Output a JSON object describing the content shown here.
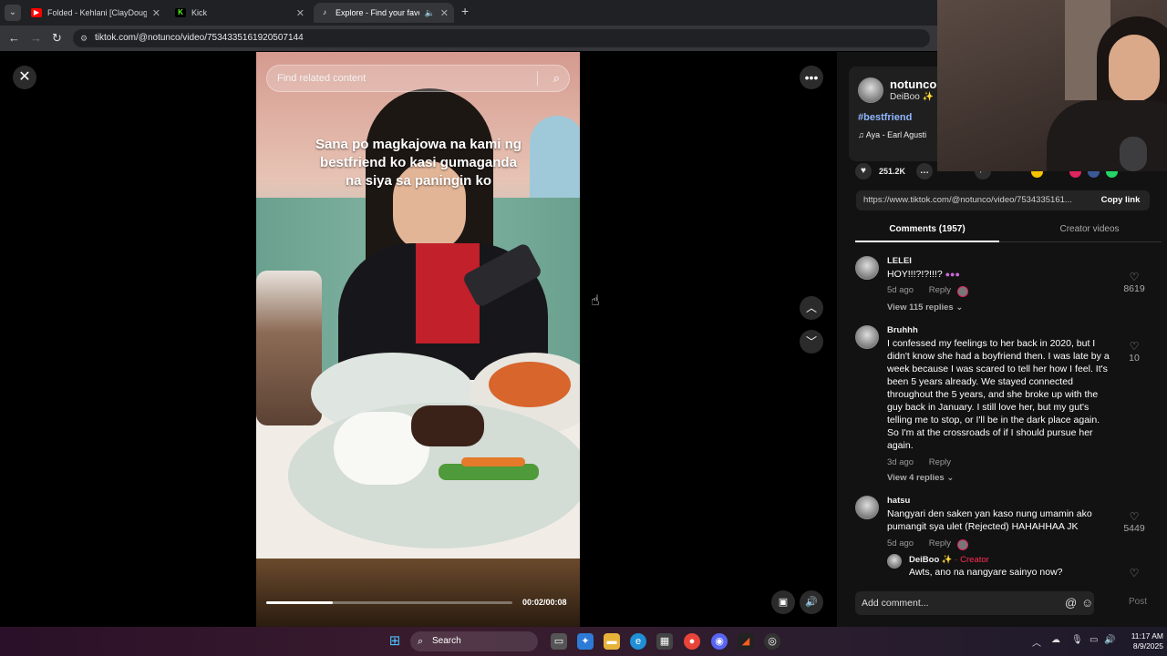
{
  "browser": {
    "tabs": [
      {
        "title": "Folded - Kehlani [ClayDough re",
        "favicon": "youtube-icon",
        "color": "#ff0000"
      },
      {
        "title": "Kick",
        "favicon": "kick-icon",
        "color": "#53fc18"
      },
      {
        "title": "Explore - Find your favourit",
        "favicon": "tiktok-icon",
        "color": "#ffffff",
        "active": true
      }
    ],
    "url": "tiktok.com/@notunco/video/7534335161920507144"
  },
  "video": {
    "search_placeholder": "Find related content",
    "caption": "Sana po magkajowa na kami ng bestfriend ko kasi gumaganda na siya sa paningin ko",
    "time": "00:02/00:08",
    "progress": 0.27
  },
  "panel": {
    "author": {
      "username": "notunco",
      "nickname": "DeiBoo ✨"
    },
    "hashtag": "#bestfriend",
    "music": "Aya - Earl Agusti",
    "stats": {
      "likes": "251.2K"
    },
    "link": "https://www.tiktok.com/@notunco/video/7534335161...",
    "copy_link_label": "Copy link",
    "tabs": {
      "comments": "Comments (1957)",
      "creator": "Creator videos"
    },
    "comments": [
      {
        "user": "LELEI",
        "text": "HOY!!!?!?!!!?",
        "time": "5d ago",
        "reply": "Reply",
        "likes": "8619",
        "replies": "View 115 replies"
      },
      {
        "user": "Bruhhh",
        "text": "I confessed my feelings to her back in 2020, but I didn't know she had a boyfriend then. I was late by a week because I was scared to tell her how I feel. It's been 5 years already. We stayed connected throughout the 5 years, and she broke up with the guy back in January. I still love her, but my gut's telling me to stop, or I'll be in the dark place again. So I'm at the crossroads of if I should pursue her again.",
        "time": "3d ago",
        "reply": "Reply",
        "likes": "10",
        "replies": "View 4 replies"
      },
      {
        "user": "hatsu",
        "text": "Nangyari den saken yan kaso nung umamin ako pumangit sya ulet (Rejected) HAHAHHAA JK",
        "time": "5d ago",
        "reply": "Reply",
        "likes": "5449"
      }
    ],
    "sub_reply": {
      "user": "DeiBoo ✨",
      "tag": "· Creator",
      "text": "Awts, ano na nangyare sainyo now?"
    },
    "add_comment_placeholder": "Add comment...",
    "post_label": "Post"
  },
  "taskbar": {
    "search": "Search",
    "time": "11:17 AM",
    "date": "8/9/2025"
  },
  "colors": {
    "accent": "#fe2c55",
    "hashtag": "#8fb7ff"
  }
}
